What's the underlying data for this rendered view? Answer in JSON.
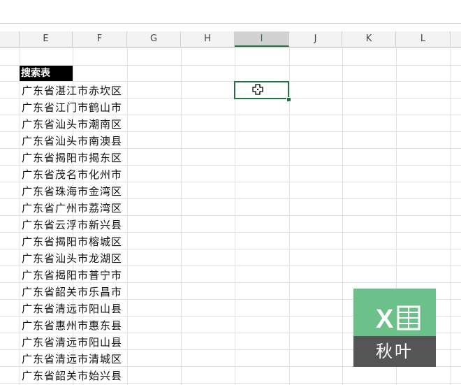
{
  "columns": [
    {
      "label": "E",
      "selected": false
    },
    {
      "label": "F",
      "selected": false
    },
    {
      "label": "G",
      "selected": false
    },
    {
      "label": "H",
      "selected": false
    },
    {
      "label": "I",
      "selected": true
    },
    {
      "label": "J",
      "selected": false
    },
    {
      "label": "K",
      "selected": false
    },
    {
      "label": "L",
      "selected": false
    }
  ],
  "table": {
    "header": "搜索表",
    "rows": [
      "广东省湛江市赤坎区",
      "广东省江门市鹤山市",
      "广东省汕头市潮南区",
      "广东省汕头市南澳县",
      "广东省揭阳市揭东区",
      "广东省茂名市化州市",
      "广东省珠海市金湾区",
      "广东省广州市荔湾区",
      "广东省云浮市新兴县",
      "广东省揭阳市榕城区",
      "广东省汕头市龙湖区",
      "广东省揭阳市普宁市",
      "广东省韶关市乐昌市",
      "广东省清远市阳山县",
      "广东省惠州市惠东县",
      "广东省清远市阳山县",
      "广东省清远市清城区",
      "广东省韶关市始兴县"
    ]
  },
  "active_cell": "I3",
  "logo": {
    "letter": "X",
    "text": "秋叶"
  },
  "colors": {
    "accent": "#217346",
    "header_bg": "#000000",
    "logo_green": "#6cc08a",
    "logo_gray": "#555555"
  }
}
